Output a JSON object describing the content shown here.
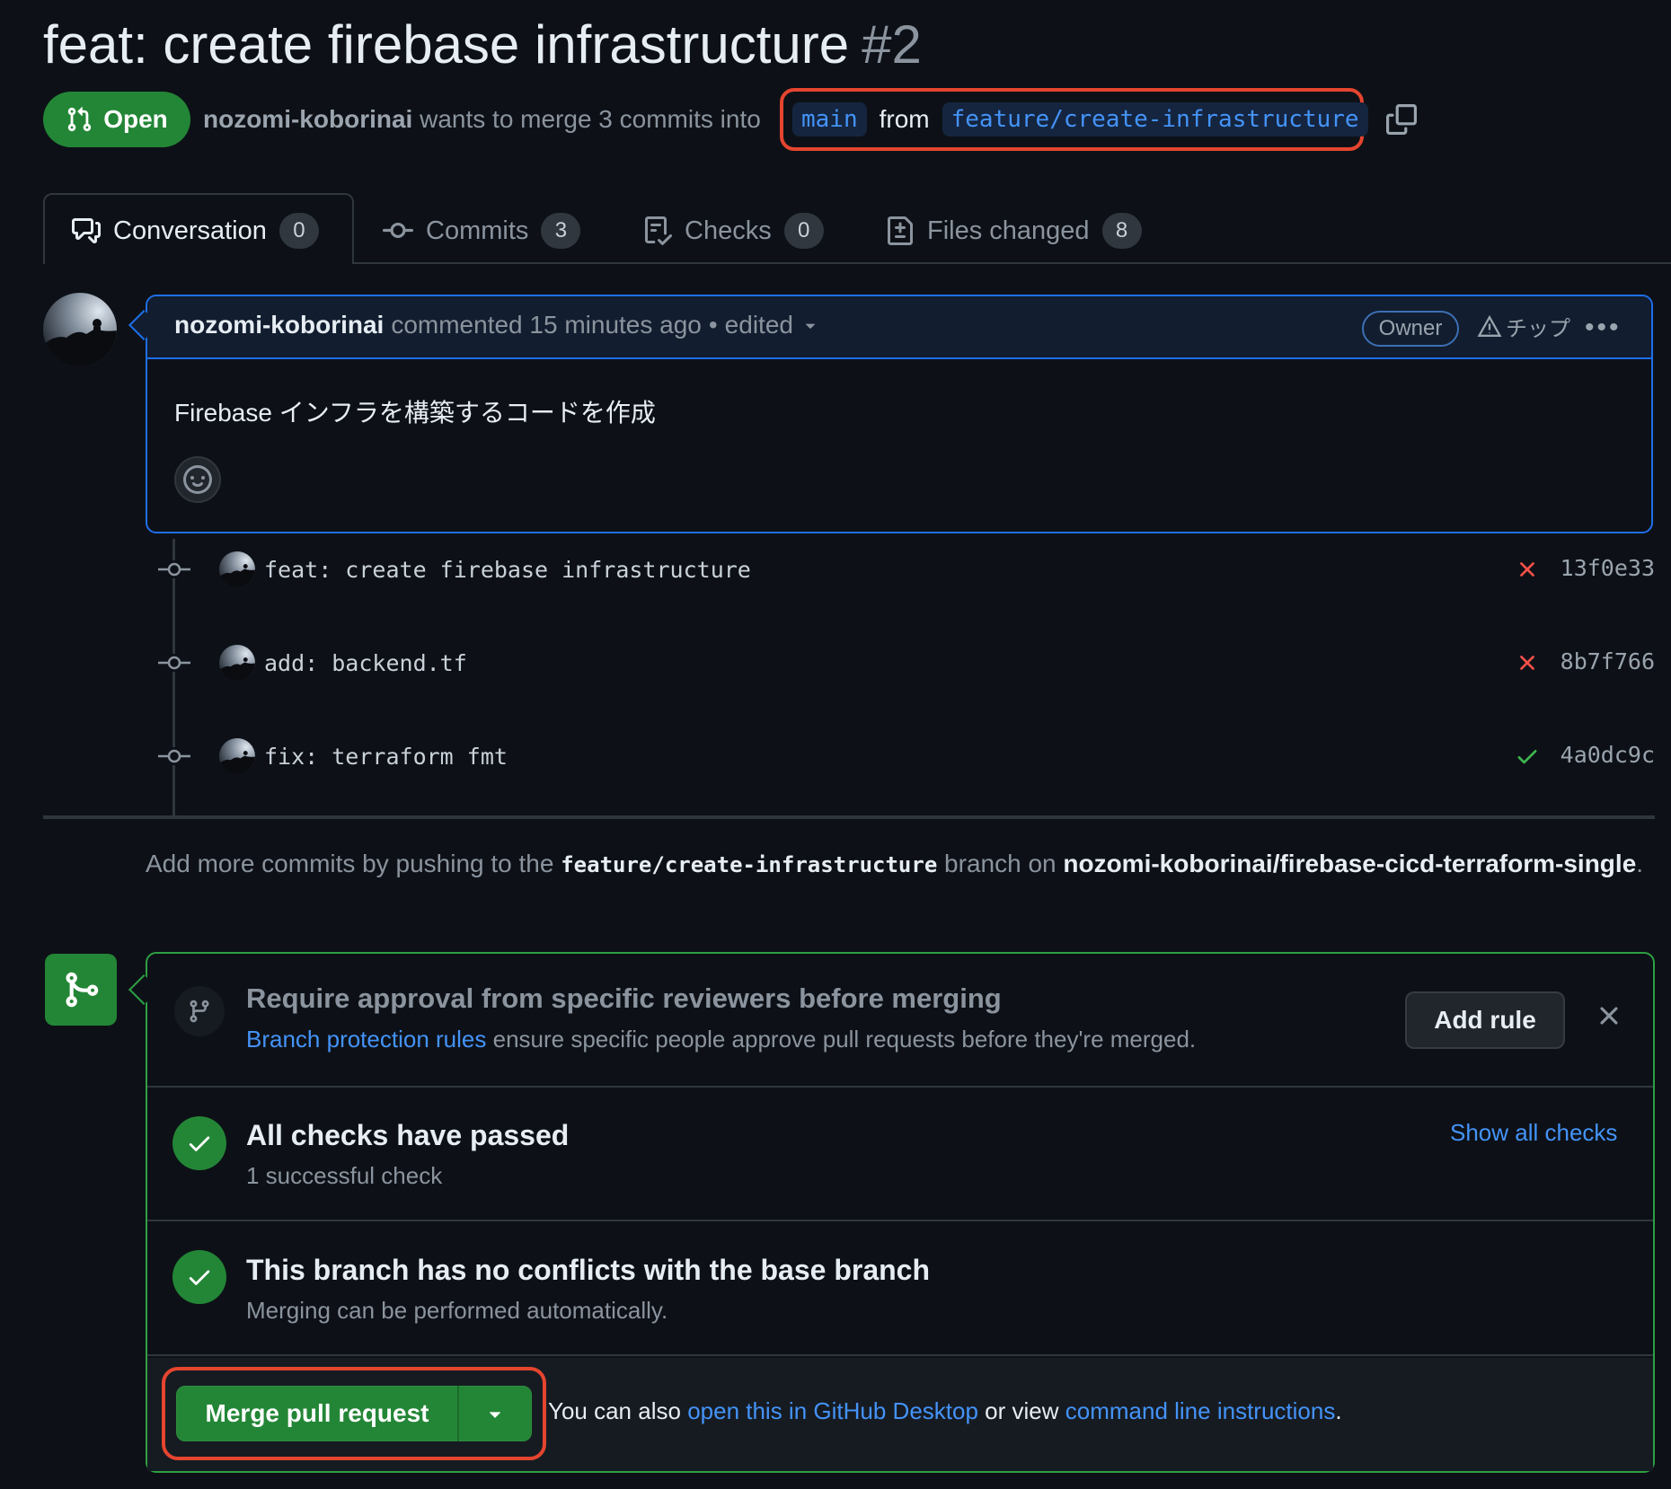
{
  "title": {
    "text": "feat: create firebase infrastructure",
    "number": "#2"
  },
  "status": {
    "label": "Open",
    "color": "#238636"
  },
  "subtitle": {
    "author": "nozomi-koborinai",
    "text": "wants to merge 3 commits into",
    "base_branch": "main",
    "from": "from",
    "head_branch": "feature/create-infrastructure"
  },
  "tabs": [
    {
      "label": "Conversation",
      "count": "0",
      "icon": "comment-discussion-icon"
    },
    {
      "label": "Commits",
      "count": "3",
      "icon": "git-commit-icon"
    },
    {
      "label": "Checks",
      "count": "0",
      "icon": "checklist-icon"
    },
    {
      "label": "Files changed",
      "count": "8",
      "icon": "file-diff-icon"
    }
  ],
  "comment": {
    "author": "nozomi-koborinai",
    "action": "commented 15 minutes ago",
    "sep": "•",
    "edited": "edited",
    "badge": "Owner",
    "tip": "チップ",
    "body": "Firebase インフラを構築するコードを作成"
  },
  "commits": [
    {
      "message": "feat: create firebase infrastructure",
      "sha": "13f0e33",
      "status": "failed"
    },
    {
      "message": "add: backend.tf",
      "sha": "8b7f766",
      "status": "failed"
    },
    {
      "message": "fix: terraform fmt",
      "sha": "4a0dc9c",
      "status": "success"
    }
  ],
  "push_note": {
    "prefix": "Add more commits by pushing to the",
    "branch": "feature/create-infrastructure",
    "mid": "branch on",
    "repo": "nozomi-koborinai/firebase-cicd-terraform-single",
    "end": "."
  },
  "merge": {
    "rule_title": "Require approval from specific reviewers before merging",
    "rule_link": "Branch protection rules",
    "rule_desc": "ensure specific people approve pull requests before they're merged.",
    "add_rule": "Add rule",
    "checks_title": "All checks have passed",
    "checks_sub": "1 successful check",
    "show_checks": "Show all checks",
    "conflict_title": "This branch has no conflicts with the base branch",
    "conflict_sub": "Merging can be performed automatically.",
    "merge_button": "Merge pull request",
    "also_prefix": "You can also",
    "desktop_link": "open this in GitHub Desktop",
    "also_mid": "or view",
    "cli_link": "command line instructions",
    "also_end": "."
  },
  "colors": {
    "background": "#0d1117",
    "accent_green": "#238636",
    "link_blue": "#4493f8",
    "fail_red": "#f85149",
    "highlight_red": "#e5452f"
  }
}
